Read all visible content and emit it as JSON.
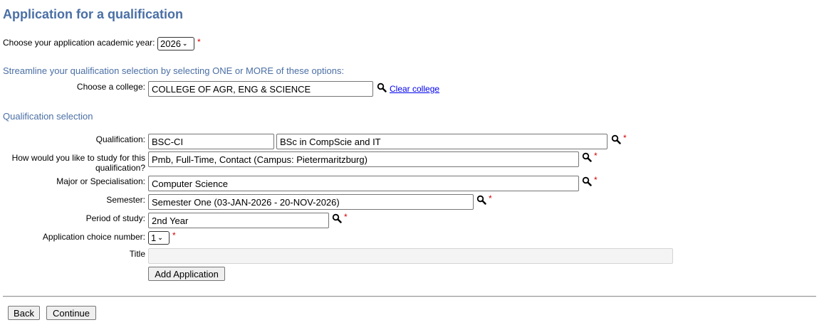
{
  "page": {
    "title": "Application for a qualification"
  },
  "academic_year": {
    "label": "Choose your application academic year:",
    "selected": "2026",
    "required_mark": "*"
  },
  "streamline": {
    "heading": "Streamline your qualification selection by selecting ONE or MORE of these options:",
    "college_label": "Choose a college:",
    "college_value": "COLLEGE OF AGR, ENG & SCIENCE",
    "clear_link": "Clear college"
  },
  "qualification_selection": {
    "heading": "Qualification selection",
    "qualification_label": "Qualification:",
    "qualification_code": "BSC-CI",
    "qualification_name": "BSc in CompScie and IT",
    "study_label_line1": "How would you like to study for this",
    "study_label_line2": "qualification?",
    "study_value": "Pmb, Full-Time, Contact (Campus: Pietermaritzburg)",
    "major_label": "Major or Specialisation:",
    "major_value": "Computer Science",
    "semester_label": "Semester:",
    "semester_value": "Semester One (03-JAN-2026 - 20-NOV-2026)",
    "period_label": "Period of study:",
    "period_value": "2nd Year",
    "choice_label": "Application choice number:",
    "choice_value": "1",
    "title_label": "Title",
    "title_value": "",
    "add_button": "Add Application",
    "required_mark": "*"
  },
  "footer": {
    "back_button": "Back",
    "continue_button": "Continue"
  },
  "colors": {
    "heading": "#4a6fa5",
    "required": "#d40000",
    "link": "#0000ee"
  },
  "icons": {
    "search": "search-icon",
    "dropdown": "chevron-down-icon"
  }
}
